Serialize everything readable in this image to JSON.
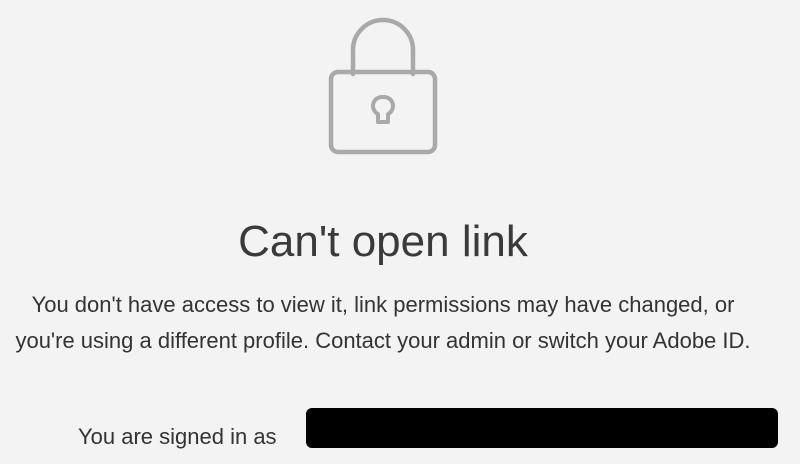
{
  "icon": {
    "name": "lock-icon",
    "color": "#a9a9a9"
  },
  "error": {
    "title": "Can't open link",
    "message": "You don't have access to view it, link permissions may have changed, or you're using a different profile. Contact your admin or switch your Adobe ID."
  },
  "account": {
    "signed_in_label": "You are signed in as",
    "value_redacted": true
  },
  "colors": {
    "background": "#f3f3f3",
    "text": "#333333",
    "icon": "#a9a9a9"
  }
}
